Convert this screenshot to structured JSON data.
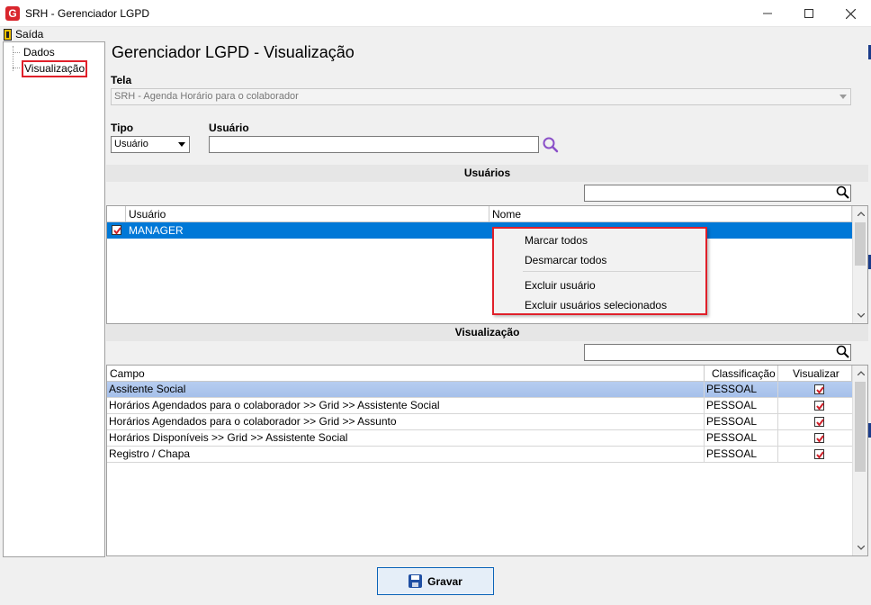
{
  "window": {
    "title": "SRH - Gerenciador LGPD",
    "logo_letter": "G",
    "controls": [
      "minimize",
      "maximize",
      "close"
    ]
  },
  "menu": {
    "saida": "Saída"
  },
  "tree": {
    "items": [
      {
        "label": "Dados"
      },
      {
        "label": "Visualização",
        "selected": true
      }
    ]
  },
  "main": {
    "title": "Gerenciador LGPD - Visualização",
    "tela_label": "Tela",
    "tela_value": "SRH - Agenda Horário para o colaborador",
    "tipo_label": "Tipo",
    "tipo_value": "Usuário",
    "usuario_label": "Usuário",
    "usuario_value": ""
  },
  "usuarios_section": {
    "header": "Usuários",
    "filter_value": "",
    "columns": [
      "Usuário",
      "Nome"
    ],
    "rows": [
      {
        "checked": true,
        "usuario": "MANAGER",
        "nome": ""
      }
    ]
  },
  "context_menu": {
    "items": [
      "Marcar todos",
      "Desmarcar todos",
      "Excluir usuário",
      "Excluir usuários selecionados"
    ]
  },
  "visualizacao_section": {
    "header": "Visualização",
    "filter_value": "",
    "columns": [
      "Campo",
      "Classificação",
      "Visualizar"
    ],
    "rows": [
      {
        "campo": "Assitente Social",
        "classificacao": "PESSOAL",
        "visualizar": true
      },
      {
        "campo": "Horários Agendados para o colaborador >> Grid >> Assistente Social",
        "classificacao": "PESSOAL",
        "visualizar": true
      },
      {
        "campo": "Horários Agendados para o colaborador >> Grid >> Assunto",
        "classificacao": "PESSOAL",
        "visualizar": true
      },
      {
        "campo": "Horários Disponíveis >> Grid >> Assistente Social",
        "classificacao": "PESSOAL",
        "visualizar": true
      },
      {
        "campo": "Registro / Chapa",
        "classificacao": "PESSOAL",
        "visualizar": true
      }
    ]
  },
  "footer": {
    "gravar_label": "Gravar"
  },
  "colors": {
    "accent_blue": "#0078d7",
    "highlight_red": "#e0202a",
    "check_red": "#d0202a",
    "search_purple": "#8a4fc8"
  }
}
